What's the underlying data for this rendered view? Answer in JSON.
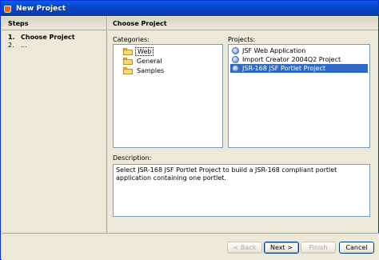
{
  "window": {
    "title": "New Project"
  },
  "steps": {
    "heading": "Steps",
    "items": [
      {
        "num": "1.",
        "label": "Choose Project"
      },
      {
        "num": "2.",
        "label": "..."
      }
    ]
  },
  "main": {
    "heading": "Choose Project",
    "categories": {
      "label": "Categories:",
      "items": [
        "Web",
        "General",
        "Samples"
      ],
      "focused": "Web"
    },
    "projects": {
      "label": "Projects:",
      "items": [
        "JSF Web Application",
        "Import Creator 2004Q2 Project",
        "JSR-168 JSF Portlet Project"
      ],
      "selected": "JSR-168 JSF Portlet Project"
    },
    "description": {
      "label": "Description:",
      "text": "Select JSR-168 JSF Portlet Project to build a JSR-168 compliant portlet application containing one portlet."
    }
  },
  "buttons": {
    "back": "< Back",
    "next": "Next >",
    "finish": "Finish",
    "cancel": "Cancel"
  },
  "colors": {
    "titlebar": "#0a4fd0",
    "selection": "#316ac5",
    "panel": "#ece9d8"
  }
}
